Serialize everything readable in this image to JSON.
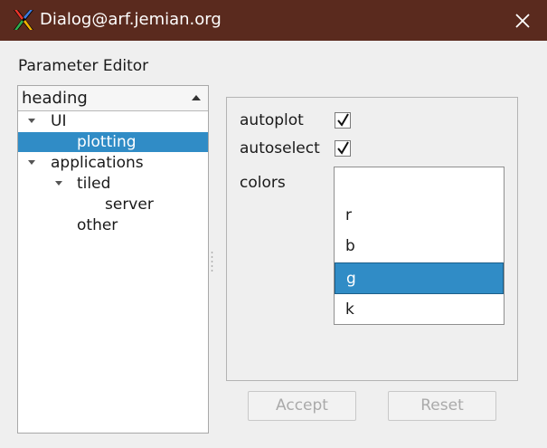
{
  "window": {
    "title": "Dialog@arf.jemian.org",
    "titlebar_color": "#5a2a1e"
  },
  "editor": {
    "label": "Parameter Editor",
    "tree": {
      "header": "heading",
      "rows": [
        {
          "label": "UI",
          "expanded": true
        },
        {
          "label": "plotting",
          "selected": true
        },
        {
          "label": "applications",
          "expanded": true
        },
        {
          "label": "tiled",
          "expanded": true
        },
        {
          "label": "server"
        },
        {
          "label": "other"
        }
      ]
    }
  },
  "settings": {
    "autoplot": {
      "label": "autoplot",
      "checked": true
    },
    "autoselect": {
      "label": "autoselect",
      "checked": true
    },
    "colors": {
      "label": "colors",
      "items": [
        "",
        "r",
        "b",
        "g",
        "k"
      ],
      "selected": "g"
    }
  },
  "buttons": {
    "accept": "Accept",
    "reset": "Reset",
    "enabled": false
  },
  "theme": {
    "selection_color": "#308cc6"
  }
}
